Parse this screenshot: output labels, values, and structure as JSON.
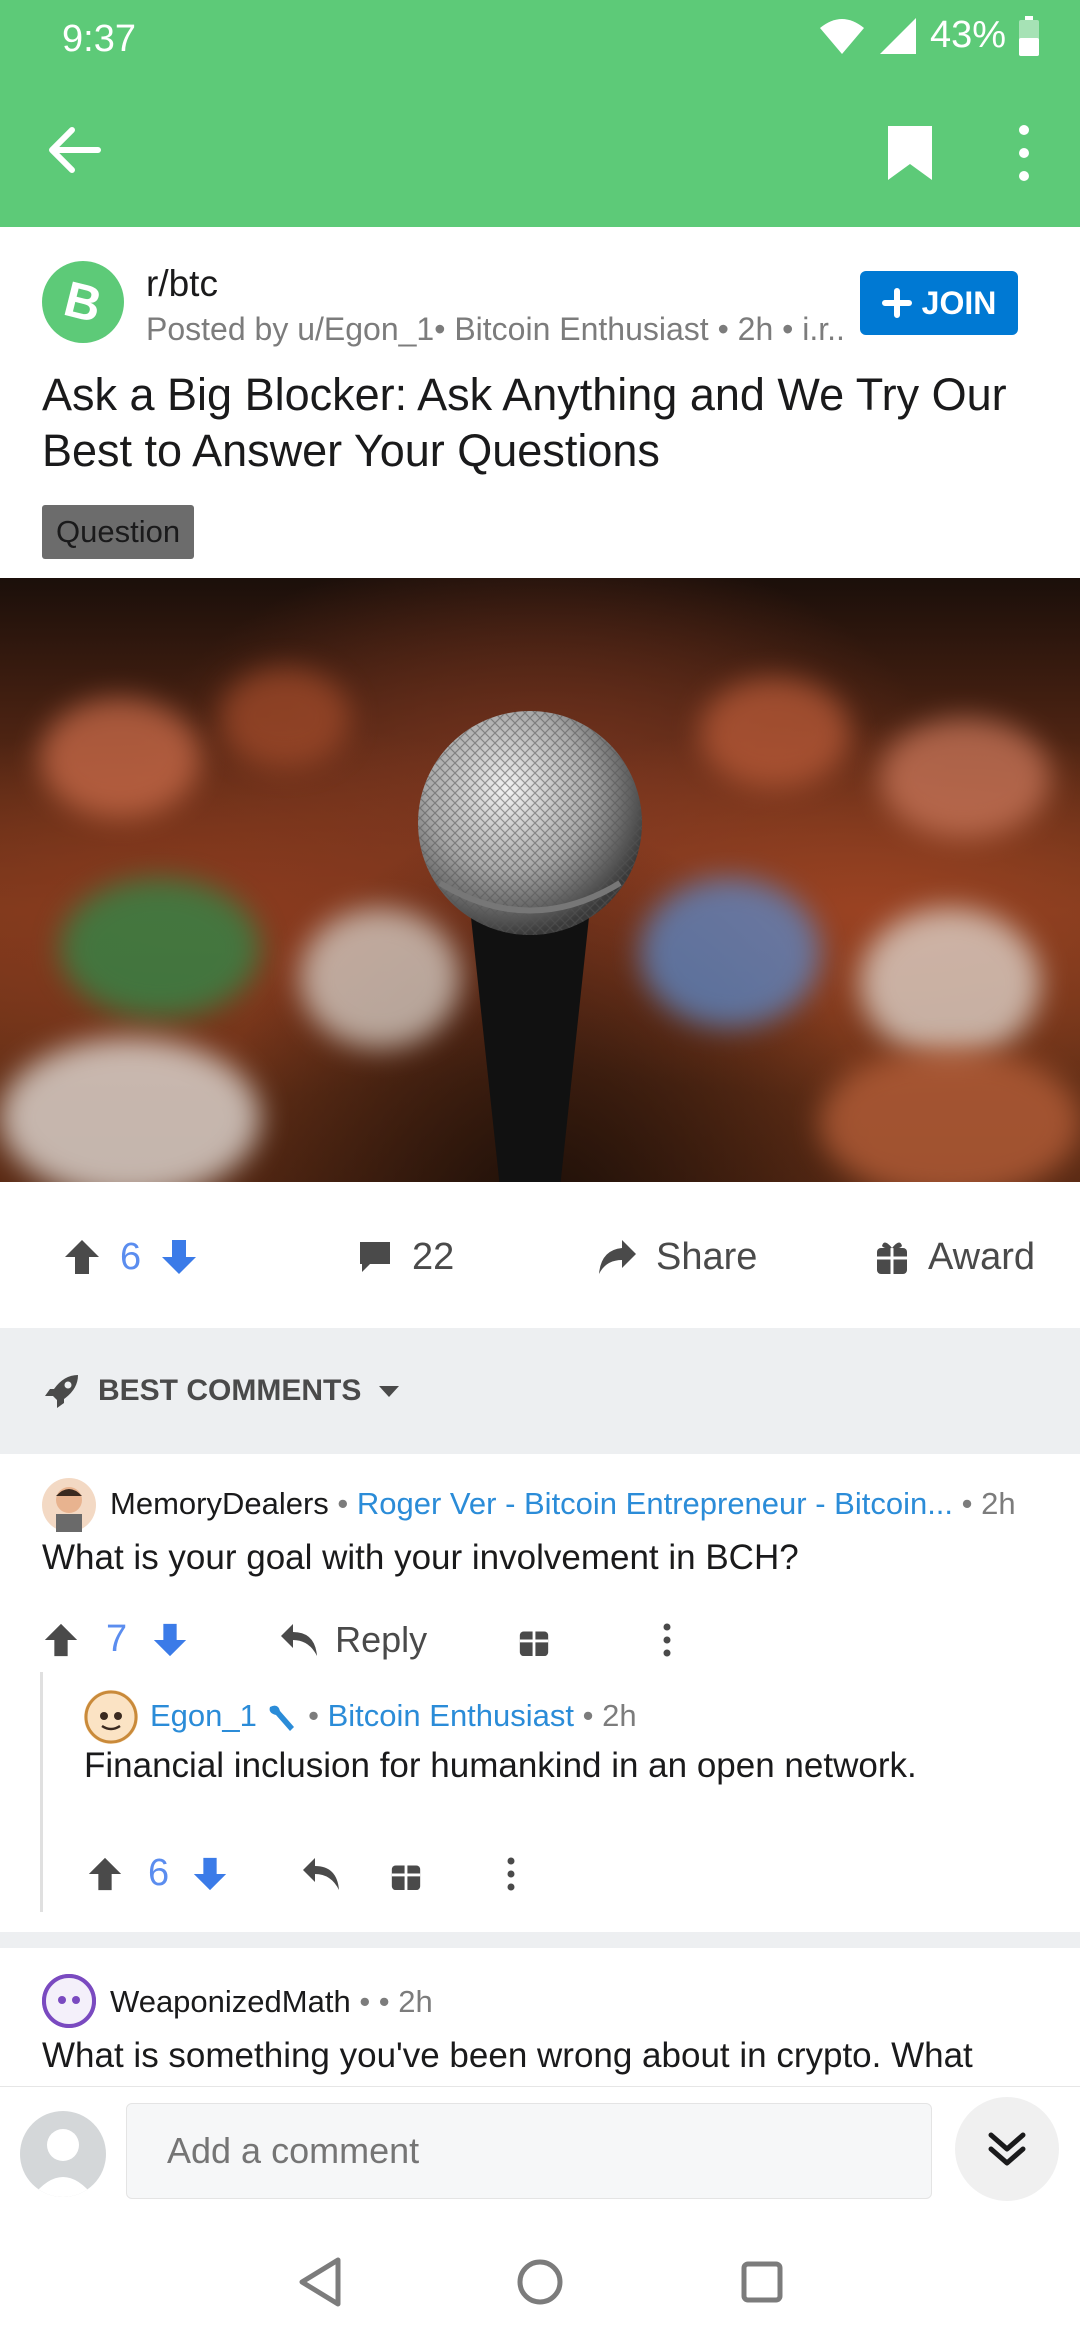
{
  "status_bar": {
    "time": "9:37",
    "battery": "43%"
  },
  "app_bar": {
    "back_icon": "arrow-left-icon",
    "bookmark_icon": "bookmark-icon",
    "more_icon": "more-vertical-icon",
    "background_color": "#5dca78"
  },
  "post": {
    "subreddit": "r/btc",
    "posted_by": "Posted by u/Egon_1• Bitcoin Enthusiast • 2h • i.r...",
    "join_label": "JOIN",
    "title": "Ask a Big Blocker: Ask Anything and We Try Our Best to Answer Your Questions",
    "flair": "Question",
    "image_icon": "microphone-image"
  },
  "actions": {
    "votes": "6",
    "comments": "22",
    "share_label": "Share",
    "award_label": "Award"
  },
  "sort": {
    "label": "BEST COMMENTS"
  },
  "comments": [
    {
      "author": "MemoryDealers",
      "sep": " • ",
      "flair": "Roger Ver - Bitcoin Entrepreneur - Bitcoin...",
      "time": " • 2h",
      "body": "What is your goal with your involvement in BCH?",
      "votes": "7",
      "reply_label": "Reply"
    },
    {
      "author": "Egon_1",
      "sep": " • ",
      "flair": "Bitcoin Enthusiast",
      "time": " • 2h",
      "body": "Financial inclusion for humankind in an open network.",
      "votes": "6"
    },
    {
      "author": "WeaponizedMath",
      "sep": " • ",
      "time": " • 2h",
      "body": "What is something you've been wrong about in crypto. What"
    }
  ],
  "composer": {
    "placeholder": "Add a comment"
  },
  "colors": {
    "accent_blue": "#0079d3",
    "vote_blue": "#5b8def",
    "flair_blue": "#2b8cd8"
  }
}
